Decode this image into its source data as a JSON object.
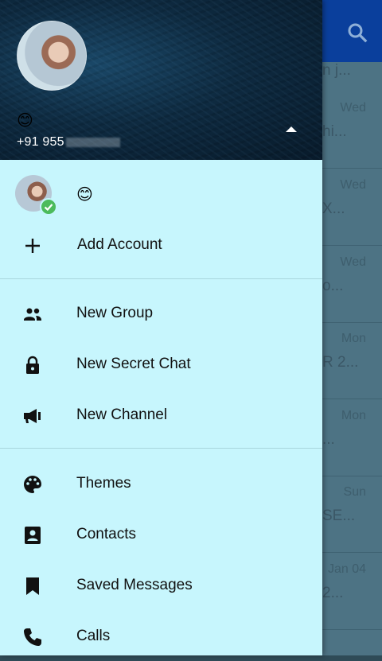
{
  "background": {
    "rows": [
      {
        "date": "Wed",
        "snippet": "hi..."
      },
      {
        "date": "Wed",
        "snippet": "X..."
      },
      {
        "date": "Wed",
        "snippet": "o..."
      },
      {
        "date": "Mon",
        "snippet": "R 2..."
      },
      {
        "date": "Mon",
        "snippet": "..."
      },
      {
        "date": "Sun",
        "snippet": "SE..."
      },
      {
        "date": "Jan 04",
        "snippet": "2..."
      }
    ],
    "top_snippet": "n j..."
  },
  "header": {
    "emoji": "😊",
    "phone": "+91 955"
  },
  "account": {
    "emoji": "😊"
  },
  "menu": {
    "add_account": "Add Account",
    "new_group": "New Group",
    "new_secret_chat": "New Secret Chat",
    "new_channel": "New Channel",
    "themes": "Themes",
    "contacts": "Contacts",
    "saved_messages": "Saved Messages",
    "calls": "Calls"
  },
  "colors": {
    "drawer_bg": "#c7f6fd",
    "app_header": "#0a3f9c",
    "check_badge": "#4cbb5c"
  }
}
